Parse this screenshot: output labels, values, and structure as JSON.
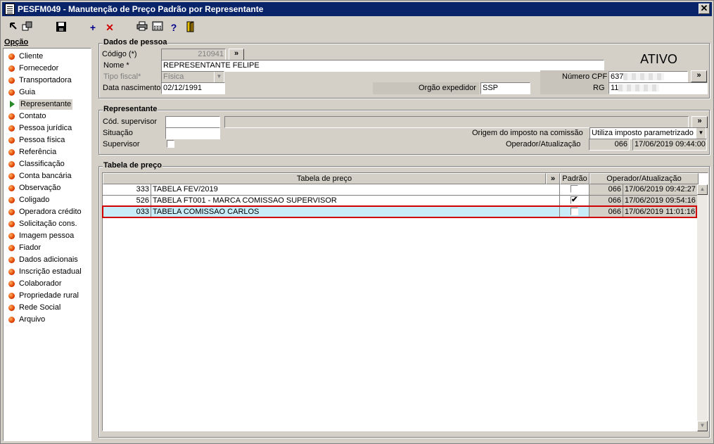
{
  "window": {
    "title": "PESFM049 - Manutenção de Preço Padrão por Representante",
    "close": "✕"
  },
  "toolbar": {
    "add": "+",
    "delete": "✕",
    "help": "?"
  },
  "sidebar": {
    "title": "Opção",
    "items": [
      {
        "label": "Cliente"
      },
      {
        "label": "Fornecedor"
      },
      {
        "label": "Transportadora"
      },
      {
        "label": "Guia"
      },
      {
        "label": "Representante"
      },
      {
        "label": "Contato"
      },
      {
        "label": "Pessoa jurídica"
      },
      {
        "label": "Pessoa física"
      },
      {
        "label": "Referência"
      },
      {
        "label": "Classificação"
      },
      {
        "label": "Conta bancária"
      },
      {
        "label": "Observação"
      },
      {
        "label": "Coligado"
      },
      {
        "label": "Operadora crédito"
      },
      {
        "label": "Solicitação cons."
      },
      {
        "label": "Imagem pessoa"
      },
      {
        "label": "Fiador"
      },
      {
        "label": "Dados adicionais"
      },
      {
        "label": "Inscrição estadual"
      },
      {
        "label": "Colaborador"
      },
      {
        "label": "Propriedade rural"
      },
      {
        "label": "Rede Social"
      },
      {
        "label": "Arquivo"
      }
    ]
  },
  "dados": {
    "title": "Dados de pessoa",
    "codigo_label": "Código (*)",
    "codigo_value": "210941",
    "nome_label": "Nome *",
    "nome_value": "REPRESENTANTE FELIPE",
    "tipo_label": "Tipo fiscal*",
    "tipo_value": "Física",
    "nasc_label": "Data nascimento",
    "nasc_value": "02/12/1991",
    "orgao_label": "Orgão expedidor",
    "orgao_value": "SSP",
    "status": "ATIVO",
    "cpf_label": "Número CPF",
    "cpf_value": "637",
    "rg_label": "RG",
    "rg_value": "11",
    "lookup": "»"
  },
  "representante": {
    "title": "Representante",
    "supervisor_code_label": "Cód. supervisor",
    "situacao_label": "Situação",
    "supervisor_label": "Supervisor",
    "origem_label": "Origem do imposto na comissão",
    "origem_value": "Utiliza imposto parametrizado",
    "operador_label": "Operador/Atualização",
    "operador_code": "066",
    "operador_date": "17/06/2019 09:44:00"
  },
  "tabela": {
    "title": "Tabela de preço",
    "headers": {
      "tabela": "Tabela de preço",
      "lookup": "»",
      "padrao": "Padrão",
      "operador": "Operador/Atualização"
    },
    "rows": [
      {
        "code": "333",
        "name": "TABELA FEV/2019",
        "padrao": "",
        "op": "066",
        "date": "17/06/2019 09:42:27"
      },
      {
        "code": "526",
        "name": "TABELA FT001 - MARCA COMISSAO SUPERVISOR",
        "padrao": "✔",
        "op": "066",
        "date": "17/06/2019 09:54:16"
      },
      {
        "code": "033",
        "name": "TABELA COMISSAO CARLOS",
        "padrao": "",
        "op": "066",
        "date": "17/06/2019 11:01:16"
      }
    ]
  }
}
